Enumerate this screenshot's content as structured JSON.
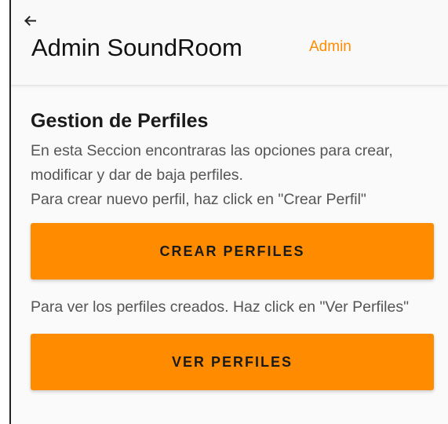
{
  "header": {
    "title": "Admin SoundRoom",
    "role": "Admin",
    "back_icon": "arrow-left-icon"
  },
  "profiles_section": {
    "title": "Gestion de Perfiles",
    "description_1": "En esta Seccion encontraras las opciones para crear, modificar y dar de baja perfiles.",
    "description_2": "Para crear nuevo perfil, haz click en \"Crear Perfil\"",
    "create_button_label": "CREAR PERFILES",
    "view_description": "Para ver los perfiles creados. Haz click en \"Ver Perfiles\"",
    "view_button_label": "VER PERFILES"
  },
  "colors": {
    "accent": "#ff8c00",
    "text": "#1a1a1a",
    "muted_text": "#555555"
  }
}
